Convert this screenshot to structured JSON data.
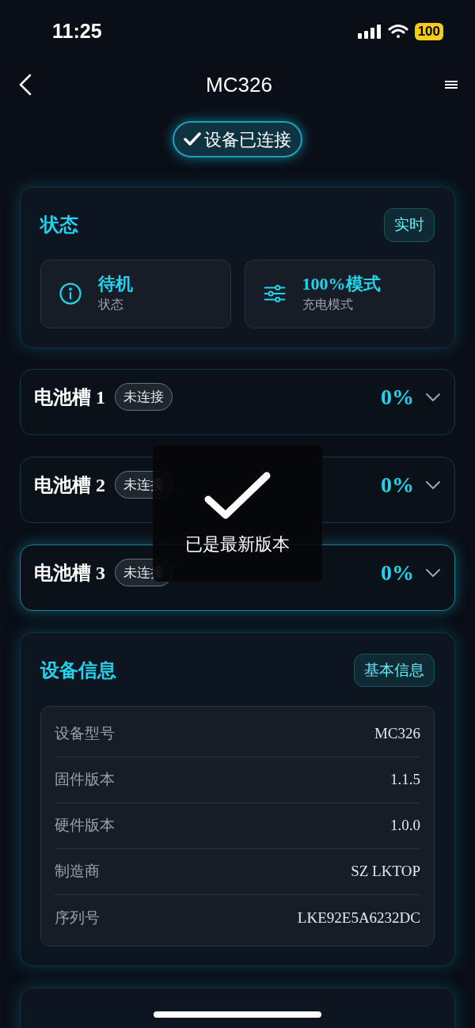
{
  "status_bar": {
    "time": "11:25",
    "battery": "100"
  },
  "header": {
    "title": "MC326"
  },
  "connection": {
    "label": "设备已连接",
    "connected": true
  },
  "status_card": {
    "title": "状态",
    "badge": "实时",
    "tiles": [
      {
        "kind": "info",
        "value": "待机",
        "label": "状态"
      },
      {
        "kind": "sliders",
        "value": "100%模式",
        "label": "充电模式"
      }
    ]
  },
  "slots": [
    {
      "name": "电池槽 1",
      "status": "未连接",
      "percent": "0%",
      "expanded": false,
      "highlighted": false
    },
    {
      "name": "电池槽 2",
      "status": "未连接",
      "percent": "0%",
      "expanded": false,
      "highlighted": false
    },
    {
      "name": "电池槽 3",
      "status": "未连接",
      "percent": "0%",
      "expanded": false,
      "highlighted": true
    }
  ],
  "device_info": {
    "title": "设备信息",
    "badge": "基本信息",
    "rows": [
      {
        "label": "设备型号",
        "value": "MC326"
      },
      {
        "label": "固件版本",
        "value": "1.1.5"
      },
      {
        "label": "硬件版本",
        "value": "1.0.0"
      },
      {
        "label": "制造商",
        "value": "SZ LKTOP"
      },
      {
        "label": "序列号",
        "value": "LKE92E5A6232DC"
      }
    ]
  },
  "toast": {
    "message": "已是最新版本"
  }
}
